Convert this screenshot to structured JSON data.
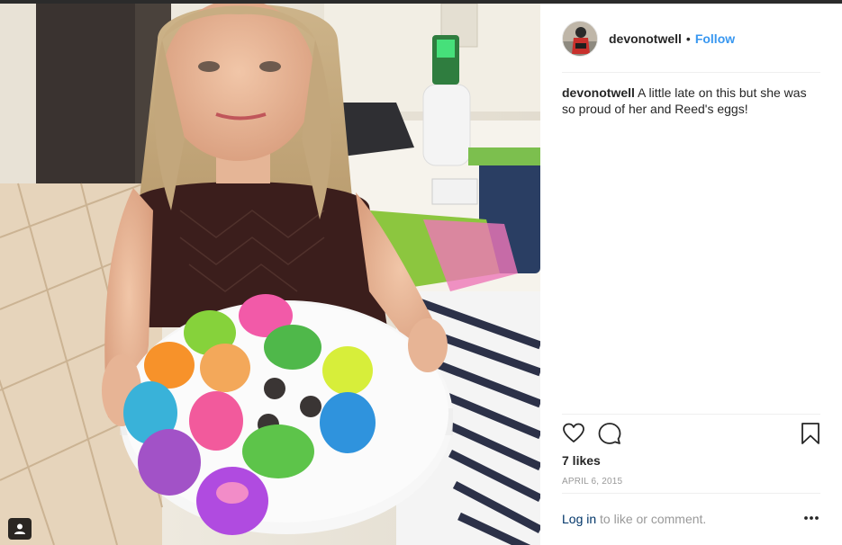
{
  "post": {
    "username": "devonotwell",
    "separator": "•",
    "follow_label": "Follow",
    "caption": {
      "username": "devonotwell",
      "text": "A little late on this but she was so proud of her and Reed's eggs!"
    },
    "likes_text": "7 likes",
    "date_text": "APRIL 6, 2015",
    "login_link": "Log in",
    "login_suffix": " to like or comment."
  },
  "icons": {
    "like": "heart-icon",
    "comment": "comment-bubble-icon",
    "save": "bookmark-icon",
    "more": "more-options-icon",
    "user_tag": "person-tag-icon"
  },
  "colors": {
    "accent_link": "#3897f0",
    "login_link": "#003569",
    "text_primary": "#262626",
    "text_muted": "#999999",
    "divider": "#efefef"
  }
}
